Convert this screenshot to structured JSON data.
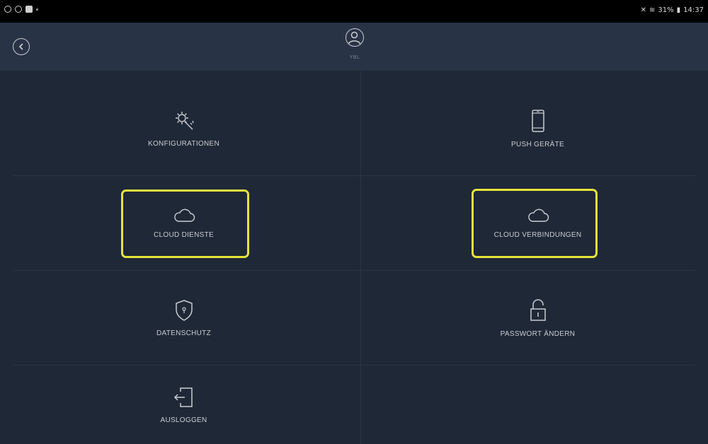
{
  "status_bar": {
    "left_icons": [
      "messenger-icon",
      "settings-icon",
      "image-icon",
      "dot-icon"
    ],
    "right_text": "31%",
    "time": "14:37"
  },
  "header": {
    "back_icon": "back-circle-icon",
    "avatar_icon": "user-circle-icon",
    "username": "YBL"
  },
  "menu": {
    "konfigurationen": "KONFIGURATIONEN",
    "push_geraete": "PUSH GERÄTE",
    "cloud_dienste": "CLOUD DIENSTE",
    "cloud_verbindungen": "CLOUD VERBINDUNGEN",
    "datenschutz": "DATENSCHUTZ",
    "passwort_aendern": "PASSWORT ÄNDERN",
    "ausloggen": "AUSLOGGEN"
  },
  "colors": {
    "background": "#1f2836",
    "header": "#283345",
    "highlight": "#e4e43a"
  }
}
